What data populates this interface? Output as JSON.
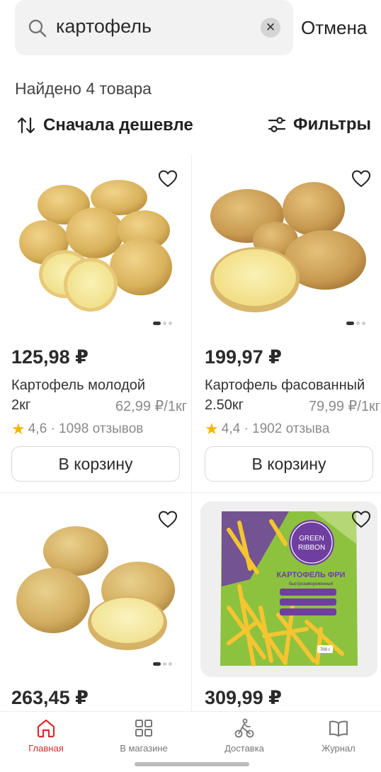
{
  "search": {
    "query": "картофель",
    "cancel_label": "Отмена"
  },
  "results": {
    "found_text": "Найдено 4 товара"
  },
  "toolbar": {
    "sort_label": "Сначала дешевле",
    "filters_label": "Фильтры"
  },
  "products": [
    {
      "price": "125,98 ₽",
      "name": "Картофель молодой",
      "weight": "2кг",
      "unit_price": "62,99 ₽/1кг",
      "rating": "4,6",
      "reviews": "· 1098 отзывов",
      "cart_label": "В корзину"
    },
    {
      "price": "199,97 ₽",
      "name": "Картофель фасованный",
      "weight": "2.50кг",
      "unit_price": "79,99 ₽/1кг",
      "rating": "4,4",
      "reviews": "· 1902 отзыва",
      "cart_label": "В корзину"
    },
    {
      "price": "263,45 ₽"
    },
    {
      "price": "309,99 ₽",
      "package": {
        "brand_line1": "GREEN",
        "brand_line2": "RIBBON",
        "title": "КАРТОФЕЛЬ ФРИ",
        "subtitle": "быстрозамороженный",
        "weight": "700 г"
      }
    }
  ],
  "bottom_nav": {
    "items": [
      {
        "label": "Главная",
        "icon": "home-icon",
        "active": true
      },
      {
        "label": "В магазине",
        "icon": "grid-icon",
        "active": false
      },
      {
        "label": "Доставка",
        "icon": "courier-icon",
        "active": false
      },
      {
        "label": "Журнал",
        "icon": "book-icon",
        "active": false
      }
    ]
  },
  "colors": {
    "accent": "#d62d2d",
    "star": "#f6b400",
    "search_bg": "#f2f2f2",
    "card_bg": "#f0efef"
  }
}
